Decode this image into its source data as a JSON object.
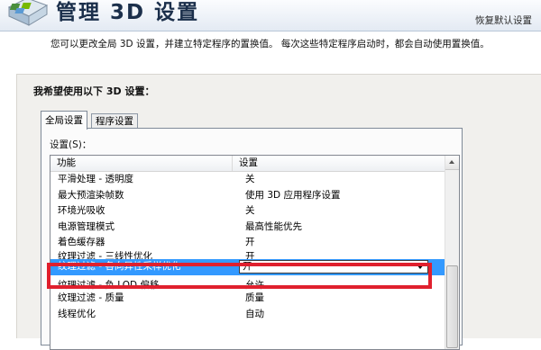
{
  "header": {
    "title": "管理 3D 设置",
    "restore_link": "恢复默认设置"
  },
  "description": "您可以更改全局 3D 设置，并建立特定程序的置换值。 每次这些特定程序启动时，都会自动使用置换值。",
  "section_heading": "我希望使用以下 3D 设置：",
  "tabs": [
    {
      "label": "全局设置",
      "active": true
    },
    {
      "label": "程序设置",
      "active": false
    }
  ],
  "settings_label": "设置(S)：",
  "columns": {
    "feature": "功能",
    "setting": "设置"
  },
  "rows": [
    {
      "feature": "平滑处理 - 透明度",
      "setting": "关"
    },
    {
      "feature": "最大预渲染帧数",
      "setting": "使用 3D 应用程序设置"
    },
    {
      "feature": "环境光吸收",
      "setting": "关"
    },
    {
      "feature": "电源管理模式",
      "setting": "最高性能优先"
    },
    {
      "feature": "着色缓存器",
      "setting": "开"
    },
    {
      "feature": "纹理过滤 - 三线性优化",
      "setting": "开"
    },
    {
      "feature": "纹理过滤 - 各向异性采样优化",
      "setting": "开",
      "selected": true
    },
    {
      "feature": "纹理过滤 - 负 LOD 偏移",
      "setting": "允许"
    },
    {
      "feature": "纹理过滤 - 质量",
      "setting": "质量"
    },
    {
      "feature": "线程优化",
      "setting": "自动"
    }
  ],
  "colors": {
    "selection": "#3399ff",
    "highlight_border": "#e0202e",
    "title": "#1b2f4b"
  }
}
